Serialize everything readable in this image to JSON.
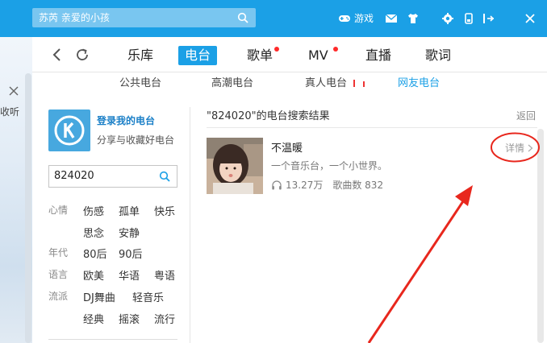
{
  "titlebar": {
    "search_text": "苏芮 亲爱的小孩",
    "game_label": "游戏",
    "bg_color": "#1ba0e6",
    "icons": [
      "search-icon",
      "gamepad-icon",
      "mail-icon",
      "tshirt-icon",
      "gear-icon",
      "mini-mode-icon",
      "exit-mini-icon",
      "close-icon"
    ]
  },
  "nav": {
    "tabs": [
      {
        "label": "乐库",
        "active": false,
        "badge": false
      },
      {
        "label": "电台",
        "active": true,
        "badge": false
      },
      {
        "label": "歌单",
        "active": false,
        "badge": true
      },
      {
        "label": "MV",
        "active": false,
        "badge": true
      },
      {
        "label": "直播",
        "active": false,
        "badge": false
      },
      {
        "label": "歌词",
        "active": false,
        "badge": false
      }
    ]
  },
  "left_strip": {
    "collapse_label": "收听"
  },
  "subtabs": [
    {
      "label": "公共电台",
      "active": false
    },
    {
      "label": "高潮电台",
      "active": false
    },
    {
      "label": "真人电台",
      "active": false
    },
    {
      "label": "网友电台",
      "active": true
    }
  ],
  "left_panel": {
    "login_title": "登录我的电台",
    "login_subtitle": "分享与收藏好电台",
    "search_value": "824020",
    "categories": [
      {
        "name": "心情",
        "tags": [
          "伤感",
          "孤单",
          "快乐",
          "思念",
          "安静"
        ]
      },
      {
        "name": "年代",
        "tags": [
          "80后",
          "90后"
        ]
      },
      {
        "name": "语言",
        "tags": [
          "欧美",
          "华语",
          "粤语"
        ]
      },
      {
        "name": "流派",
        "tags": [
          "DJ舞曲",
          "轻音乐",
          "经典",
          "摇滚",
          "流行"
        ]
      }
    ]
  },
  "results": {
    "title": "\"824020\"的电台搜索结果",
    "back_label": "返回",
    "station": {
      "name": "不温暖",
      "description": "一个音乐台，一个小世界。",
      "listeners": "13.27万",
      "songs": "歌曲数 832",
      "detail_label": "详情"
    }
  },
  "annotation_color": "#e8271d"
}
